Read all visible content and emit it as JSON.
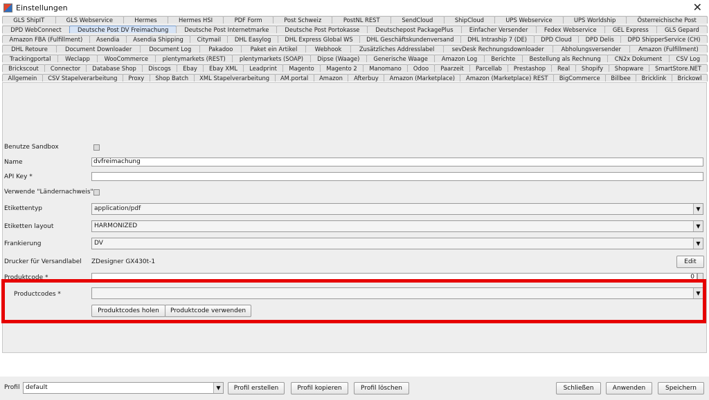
{
  "window": {
    "title": "Einstellungen",
    "close": "✕"
  },
  "tabs": {
    "rows": [
      [
        "GLS ShipIT",
        "GLS Webservice",
        "Hermes",
        "Hermes HSI",
        "PDF Form",
        "Post Schweiz",
        "PostNL REST",
        "SendCloud",
        "ShipCloud",
        "UPS Webservice",
        "UPS Worldship",
        "Österreichische Post"
      ],
      [
        "DPD WebConnect",
        "Deutsche Post DV Freimachung",
        "Deutsche Post Internetmarke",
        "Deutsche Post Portokasse",
        "Deutschepost PackagePlus",
        "Einfacher Versender",
        "Fedex Webservice",
        "GEL Express",
        "GLS Gepard"
      ],
      [
        "Amazon FBA (Fulfillment)",
        "Asendia",
        "Asendia Shipping",
        "Citymail",
        "DHL Easylog",
        "DHL Express Global WS",
        "DHL Geschäftskundenversand",
        "DHL Intraship 7 (DE)",
        "DPD Cloud",
        "DPD Delis",
        "DPD ShipperService (CH)"
      ],
      [
        "DHL Retoure",
        "Document Downloader",
        "Document Log",
        "Pakadoo",
        "Paket ein Artikel",
        "Webhook",
        "Zusätzliches Addresslabel",
        "sevDesk Rechnungsdownloader",
        "Abholungsversender",
        "Amazon (Fulfillment)"
      ],
      [
        "Trackingportal",
        "Weclapp",
        "WooCommerce",
        "plentymarkets (REST)",
        "plentymarkets (SOAP)",
        "Dipse (Waage)",
        "Generische Waage",
        "Amazon Log",
        "Berichte",
        "Bestellung als Rechnung",
        "CN2x Dokument",
        "CSV Log"
      ],
      [
        "Brickscout",
        "Connector",
        "Database Shop",
        "Discogs",
        "Ebay",
        "Ebay XML",
        "Leadprint",
        "Magento",
        "Magento 2",
        "Manomano",
        "Odoo",
        "Paarzeit",
        "Parcellab",
        "Prestashop",
        "Real",
        "Shopify",
        "Shopware",
        "SmartStore.NET"
      ],
      [
        "Allgemein",
        "CSV Stapelverarbeitung",
        "Proxy",
        "Shop Batch",
        "XML Stapelverarbeitung",
        "AM.portal",
        "Amazon",
        "Afterbuy",
        "Amazon (Marketplace)",
        "Amazon (Marketplace) REST",
        "BigCommerce",
        "Billbee",
        "Bricklink",
        "Brickowl"
      ]
    ],
    "active": "Deutsche Post DV Freimachung"
  },
  "form": {
    "sandbox_label": "Benutze Sandbox",
    "name_label": "Name",
    "name_value": "dvfreimachung",
    "apikey_label": "API Key *",
    "apikey_value": "",
    "laender_label": "Verwende \"Ländernachweis\"",
    "etikettentyp_label": "Etikettentyp",
    "etikettentyp_value": "application/pdf",
    "layout_label": "Etiketten layout",
    "layout_value": "HARMONIZED",
    "frankierung_label": "Frankierung",
    "frankierung_value": "DV",
    "drucker_label": "Drucker für Versandlabel",
    "drucker_value": "ZDesigner GX430t-1",
    "edit_button": "Edit",
    "produktcode_label": "Produktcode *",
    "produktcode_value": "0",
    "productcodes_label": "Productcodes *",
    "productcodes_value": "",
    "holen_button": "Produktcodes holen",
    "verwenden_button": "Produktcode verwenden"
  },
  "bottom": {
    "profil_label": "Profil",
    "profil_value": "default",
    "erstellen": "Profil erstellen",
    "kopieren": "Profil kopieren",
    "loeschen": "Profil löschen",
    "schliessen": "Schließen",
    "anwenden": "Anwenden",
    "speichern": "Speichern"
  },
  "icons": {
    "dropdown": "▼"
  },
  "colors": {
    "highlight": "#e60000",
    "active_tab": "#d6e3f5"
  }
}
